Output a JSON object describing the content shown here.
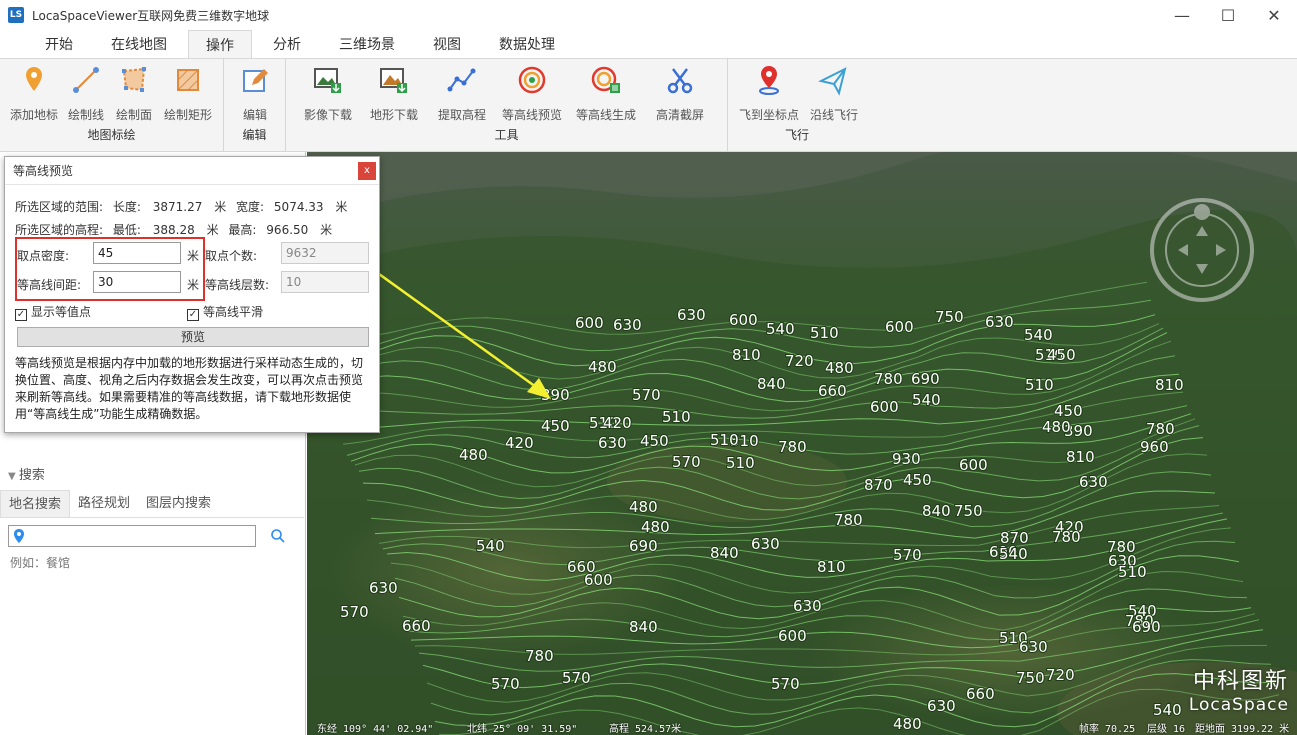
{
  "app": {
    "title": "LocaSpaceViewer互联网免费三维数字地球",
    "logo_text": "LS",
    "icon": "app-logo-icon"
  },
  "window_controls": {
    "minimize": "—",
    "maximize": "☐",
    "close": "✕"
  },
  "menu": [
    "开始",
    "在线地图",
    "操作",
    "分析",
    "三维场景",
    "视图",
    "数据处理"
  ],
  "menu_active": "操作",
  "ribbon": {
    "groups": [
      {
        "label": "地图标绘",
        "buttons": [
          {
            "label": "添加地标",
            "icon": "placemark-icon"
          },
          {
            "label": "绘制线",
            "icon": "draw-line-icon"
          },
          {
            "label": "绘制面",
            "icon": "draw-polygon-icon"
          },
          {
            "label": "绘制矩形",
            "icon": "draw-rectangle-icon"
          }
        ]
      },
      {
        "label": "编辑",
        "buttons": [
          {
            "label": "编辑",
            "icon": "edit-icon"
          }
        ]
      },
      {
        "label": "工具",
        "buttons": [
          {
            "label": "影像下载",
            "icon": "image-download-icon"
          },
          {
            "label": "地形下载",
            "icon": "terrain-download-icon"
          },
          {
            "label": "提取高程",
            "icon": "extract-elevation-icon"
          },
          {
            "label": "等高线预览",
            "icon": "contour-preview-icon"
          },
          {
            "label": "等高线生成",
            "icon": "contour-generate-icon"
          },
          {
            "label": "高清截屏",
            "icon": "screenshot-icon"
          }
        ]
      },
      {
        "label": "飞行",
        "buttons": [
          {
            "label": "飞到坐标点",
            "icon": "fly-to-point-icon"
          },
          {
            "label": "沿线飞行",
            "icon": "fly-along-line-icon"
          }
        ]
      }
    ]
  },
  "dialog": {
    "title": "等高线预览",
    "close_label": "x",
    "range_label": "所选区域的范围:",
    "length_label": "长度:",
    "length_value": "3871.27",
    "width_label": "宽度:",
    "width_value": "5074.33",
    "unit": "米",
    "elev_label": "所选区域的高程:",
    "min_label": "最低:",
    "min_value": "388.28",
    "max_label": "最高:",
    "max_value": "966.50",
    "density_label": "取点密度:",
    "density_value": "45",
    "interval_label": "等高线间距:",
    "interval_value": "30",
    "count_label": "取点个数:",
    "count_value": "9632",
    "layers_label": "等高线层数:",
    "layers_value": "10",
    "show_points_label": "显示等值点",
    "smooth_label": "等高线平滑",
    "check_mark": "✓",
    "preview_button": "预览",
    "description": "等高线预览是根据内存中加载的地形数据进行采样动态生成的，切换位置、高度、视角之后内存数据会发生改变，可以再次点击预览来刷新等高线。如果需要精准的等高线数据，请下载地形数据使用“等高线生成”功能生成精确数据。"
  },
  "search": {
    "header": "搜索",
    "tabs": [
      "地名搜索",
      "路径规划",
      "图层内搜索"
    ],
    "active_tab": "地名搜索",
    "placeholder": "",
    "hint": "例如：餐馆"
  },
  "map": {
    "contour_labels": [
      "600",
      "630",
      "630",
      "600",
      "540",
      "510",
      "600",
      "750",
      "630",
      "540",
      "510",
      "480",
      "810",
      "720",
      "450",
      "480",
      "660",
      "780",
      "690",
      "510",
      "390",
      "450",
      "510",
      "570",
      "840",
      "600",
      "540",
      "450",
      "390",
      "510",
      "510",
      "780",
      "960",
      "810",
      "780",
      "420",
      "420",
      "480",
      "630",
      "450",
      "510",
      "570",
      "510",
      "930",
      "600",
      "480",
      "630",
      "810",
      "870",
      "450",
      "840",
      "480",
      "750",
      "780",
      "480",
      "420",
      "540",
      "630",
      "690",
      "870",
      "780",
      "540",
      "690",
      "840",
      "570",
      "780",
      "660",
      "810",
      "630",
      "510",
      "600",
      "630",
      "630",
      "570",
      "660",
      "840",
      "600",
      "540",
      "780",
      "510",
      "630",
      "690",
      "780",
      "570",
      "750",
      "720",
      "570",
      "630",
      "660",
      "570",
      "480",
      "540"
    ],
    "status": {
      "lon": "东经 109° 44' 02.94\"",
      "lat": "北纬 25° 09' 31.59\"",
      "alt": "高程 524.57米",
      "fps": "帧率 70.25",
      "level": "层级 16",
      "dist": "距地面 3199.22 米"
    },
    "brand_cn": "中科图新",
    "brand_en": "LocaSpace"
  }
}
